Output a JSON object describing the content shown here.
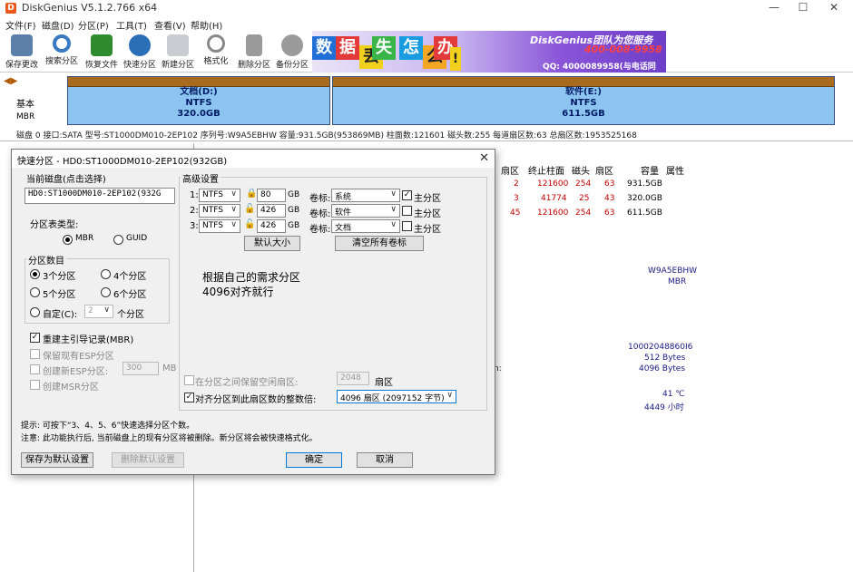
{
  "window": {
    "title": "DiskGenius V5.1.2.766 x64",
    "minimize": "—",
    "maximize": "☐",
    "close": "✕"
  },
  "menu": [
    "文件(F)",
    "磁盘(D)",
    "分区(P)",
    "工具(T)",
    "查看(V)",
    "帮助(H)"
  ],
  "toolbar": [
    {
      "label": "保存更改",
      "icon": "save-icon",
      "color": "#5b7fa8"
    },
    {
      "label": "搜索分区",
      "icon": "search-icon",
      "color": "#3a78c0"
    },
    {
      "label": "恢复文件",
      "icon": "recover-icon",
      "color": "#2e8b2e"
    },
    {
      "label": "快速分区",
      "icon": "quick-partition-icon",
      "color": "#2b6fb8"
    },
    {
      "label": "新建分区",
      "icon": "new-partition-icon",
      "color": "#9aa0a8"
    },
    {
      "label": "格式化",
      "icon": "format-icon",
      "color": "#7a7a7a"
    },
    {
      "label": "删除分区",
      "icon": "delete-icon",
      "color": "#7a7a7a"
    },
    {
      "label": "备份分区",
      "icon": "backup-icon",
      "color": "#7a7a7a"
    }
  ],
  "banner": {
    "tiles": [
      "数",
      "据",
      "丢",
      "失",
      "怎",
      "么",
      "办",
      "!"
    ],
    "line1": "DiskGenius团队为您服务",
    "line2": "400-008-9958",
    "line3": "QQ: 4000089958(与电话同号)",
    "line4": "DiskGenius团队为您服务"
  },
  "diskmap": {
    "nav": "◀▶",
    "label1": "基本",
    "label2": "MBR",
    "partitions": [
      {
        "name": "文档(D:)",
        "fs": "NTFS",
        "size": "320.0GB"
      },
      {
        "name": "软件(E:)",
        "fs": "NTFS",
        "size": "611.5GB"
      }
    ]
  },
  "diskinfo": "磁盘 0 接口:SATA  型号:ST1000DM010-2EP102  序列号:W9A5EBHW  容量:931.5GB(953869MB)  柱面数:121601  磁头数:255  每道扇区数:63  总扇区数:1953525168",
  "table": {
    "headers": [
      "扇区",
      "终止柱面",
      "磁头",
      "扇区",
      "容量",
      "属性"
    ],
    "rows": [
      {
        "c1": "2",
        "c2": "121600",
        "c3": "254",
        "c4": "63",
        "c5": "931.5GB"
      },
      {
        "c1": "3",
        "c2": "41774",
        "c3": "25",
        "c4": "43",
        "c5": "320.0GB"
      },
      {
        "c1": "45",
        "c2": "121600",
        "c3": "254",
        "c4": "63",
        "c5": "611.5GB"
      }
    ]
  },
  "details": {
    "serial": "W9A5EBHW",
    "type": "MBR",
    "a": "10002048860I6",
    "b": "512 Bytes",
    "c": "4096 Bytes",
    "colon": "n:",
    "temp": "41 ℃",
    "hours": "4449 小时"
  },
  "dialog": {
    "title": "快速分区 - HD0:ST1000DM010-2EP102(932GB)",
    "close": "✕",
    "current_disk_label": "当前磁盘(点击选择)",
    "current_disk_value": "HD0:ST1000DM010-2EP102(932G",
    "table_type_label": "分区表类型:",
    "mbr": "MBR",
    "guid": "GUID",
    "count_label": "分区数目",
    "count_options": [
      "3个分区",
      "4个分区",
      "5个分区",
      "6个分区"
    ],
    "custom_label": "自定(C):",
    "custom_value": "2",
    "custom_unit": "个分区",
    "rebuild_mbr": "重建主引导记录(MBR)",
    "keep_esp": "保留现有ESP分区",
    "create_esp": "创建新ESP分区:",
    "esp_size": "300",
    "esp_unit": "MB",
    "create_msr": "创建MSR分区",
    "advanced_label": "高级设置",
    "rows": [
      {
        "idx": "1:",
        "fs": "NTFS",
        "size": "80",
        "unit": "GB",
        "vol_label": "卷标:",
        "vol": "系统",
        "primary": "主分区",
        "primary_checked": "✓"
      },
      {
        "idx": "2:",
        "fs": "NTFS",
        "size": "426",
        "unit": "GB",
        "vol_label": "卷标:",
        "vol": "软件",
        "primary": "主分区",
        "primary_checked": ""
      },
      {
        "idx": "3:",
        "fs": "NTFS",
        "size": "426",
        "unit": "GB",
        "vol_label": "卷标:",
        "vol": "文档",
        "primary": "主分区",
        "primary_checked": ""
      }
    ],
    "default_size_btn": "默认大小",
    "clear_labels_btn": "清空所有卷标",
    "note_line1": "根据自己的需求分区",
    "note_line2": "4096对齐就行",
    "reserve_label": "在分区之间保留空闲扇区:",
    "reserve_value": "2048",
    "reserve_unit": "扇区",
    "align_label": "对齐分区到此扇区数的整数倍:",
    "align_value": "4096 扇区 (2097152 字节)",
    "hint1": "提示: 可按下“3、4、5、6”快速选择分区个数。",
    "hint2": "注意: 此功能执行后, 当前磁盘上的现有分区将被删除。新分区将会被快速格式化。",
    "save_default_btn": "保存为默认设置",
    "delete_default_btn": "删除默认设置",
    "ok_btn": "确定",
    "cancel_btn": "取消"
  }
}
